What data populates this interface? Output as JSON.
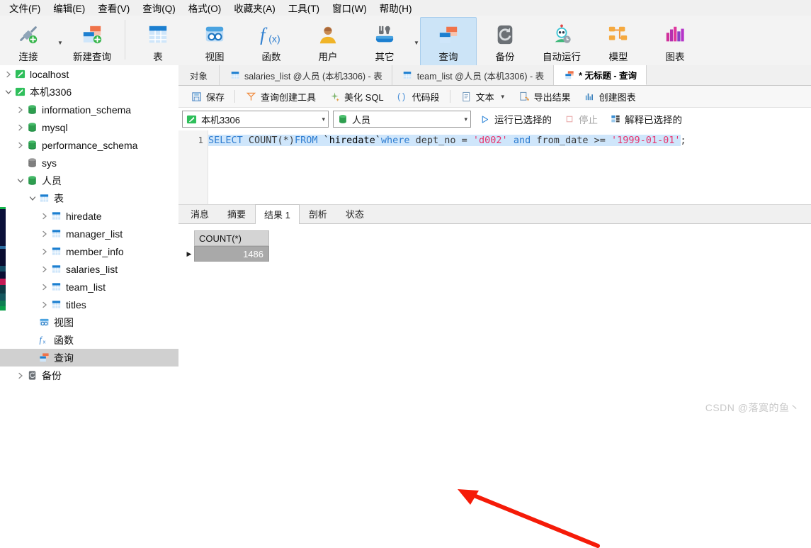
{
  "menu": {
    "items": [
      "文件(F)",
      "编辑(E)",
      "查看(V)",
      "查询(Q)",
      "格式(O)",
      "收藏夹(A)",
      "工具(T)",
      "窗口(W)",
      "帮助(H)"
    ]
  },
  "toolbar": {
    "items": [
      {
        "label": "连接",
        "icon": "plug-connect-icon",
        "selected": false
      },
      {
        "label": "新建查询",
        "icon": "new-query-icon",
        "selected": false
      },
      {
        "label": "表",
        "icon": "table-icon",
        "selected": false
      },
      {
        "label": "视图",
        "icon": "view-icon",
        "selected": false
      },
      {
        "label": "函数",
        "icon": "function-fx-icon",
        "selected": false
      },
      {
        "label": "用户",
        "icon": "user-icon",
        "selected": false
      },
      {
        "label": "其它",
        "icon": "other-tools-icon",
        "selected": false
      },
      {
        "label": "查询",
        "icon": "query-icon",
        "selected": true
      },
      {
        "label": "备份",
        "icon": "backup-icon",
        "selected": false
      },
      {
        "label": "自动运行",
        "icon": "automation-robot-icon",
        "selected": false
      },
      {
        "label": "模型",
        "icon": "model-icon",
        "selected": false
      },
      {
        "label": "图表",
        "icon": "chart-icon",
        "selected": false
      }
    ]
  },
  "sidebar": {
    "nodes": [
      {
        "label": "localhost",
        "icon": "connection-icon",
        "indent": 0,
        "expander": "collapsed",
        "active": false
      },
      {
        "label": "本机3306",
        "icon": "connection-icon",
        "indent": 0,
        "expander": "expanded",
        "active": false
      },
      {
        "label": "information_schema",
        "icon": "database-icon",
        "indent": 1,
        "expander": "collapsed",
        "active": false
      },
      {
        "label": "mysql",
        "icon": "database-icon",
        "indent": 1,
        "expander": "collapsed",
        "active": false
      },
      {
        "label": "performance_schema",
        "icon": "database-icon",
        "indent": 1,
        "expander": "collapsed",
        "active": false
      },
      {
        "label": "sys",
        "icon": "database-gray-icon",
        "indent": 1,
        "expander": "none",
        "active": false
      },
      {
        "label": "人员",
        "icon": "database-icon",
        "indent": 1,
        "expander": "expanded",
        "active": false
      },
      {
        "label": "表",
        "icon": "table-icon",
        "indent": 2,
        "expander": "expanded",
        "active": false
      },
      {
        "label": "hiredate",
        "icon": "table-icon",
        "indent": 3,
        "expander": "collapsed",
        "active": false
      },
      {
        "label": "manager_list",
        "icon": "table-icon",
        "indent": 3,
        "expander": "collapsed",
        "active": false
      },
      {
        "label": "member_info",
        "icon": "table-icon",
        "indent": 3,
        "expander": "collapsed",
        "active": false
      },
      {
        "label": "salaries_list",
        "icon": "table-icon",
        "indent": 3,
        "expander": "collapsed",
        "active": false
      },
      {
        "label": "team_list",
        "icon": "table-icon",
        "indent": 3,
        "expander": "collapsed",
        "active": false
      },
      {
        "label": "titles",
        "icon": "table-icon",
        "indent": 3,
        "expander": "collapsed",
        "active": false
      },
      {
        "label": "视图",
        "icon": "view-icon",
        "indent": 2,
        "expander": "none",
        "active": false
      },
      {
        "label": "函数",
        "icon": "function-fx-icon",
        "indent": 2,
        "expander": "none",
        "active": false
      },
      {
        "label": "查询",
        "icon": "query-icon",
        "indent": 2,
        "expander": "none",
        "active": true
      },
      {
        "label": "备份",
        "icon": "backup-icon",
        "indent": 1,
        "expander": "collapsed",
        "active": false
      }
    ]
  },
  "tabs": {
    "object_label": "对象",
    "items": [
      {
        "label": "salaries_list @人员 (本机3306) - 表",
        "icon": "table-icon",
        "selected": false
      },
      {
        "label": "team_list @人员 (本机3306) - 表",
        "icon": "table-icon",
        "selected": false
      },
      {
        "label": "* 无标题 - 查询",
        "icon": "query-icon",
        "selected": true
      }
    ]
  },
  "query_toolbar": {
    "items": [
      {
        "label": "保存",
        "icon": "save-icon"
      },
      {
        "label": "查询创建工具",
        "icon": "query-builder-icon"
      },
      {
        "label": "美化 SQL",
        "icon": "beautify-sql-icon"
      },
      {
        "label": "代码段",
        "icon": "code-snippet-icon"
      },
      {
        "label": "文本",
        "icon": "text-icon",
        "caret": true
      },
      {
        "label": "导出结果",
        "icon": "export-result-icon"
      },
      {
        "label": "创建图表",
        "icon": "create-chart-icon"
      }
    ]
  },
  "connection_bar": {
    "connection": "本机3306",
    "database": "人员",
    "run_selected": "运行已选择的",
    "stop": "停止",
    "explain_selected": "解释已选择的"
  },
  "editor": {
    "line_number": "1",
    "sql_full": "SELECT COUNT(*)FROM `hiredate`where dept_no = 'd002' and from_date >= '1999-01-01';",
    "tokens": {
      "t1": "SELECT",
      "t2": " COUNT(*)",
      "t3": "FROM",
      "t4": " `hiredate`",
      "t5": "where",
      "t6": " dept_no = ",
      "t7": "'d002'",
      "t8": " and",
      "t9": " from_date >= ",
      "t10": "'1999-01-01'",
      "t11": ";"
    }
  },
  "result_tabs": {
    "items": [
      {
        "label": "消息",
        "selected": false
      },
      {
        "label": "结果 1",
        "selected": true
      },
      {
        "label": "剖析",
        "selected": false
      },
      {
        "label": "状态",
        "selected": false
      }
    ],
    "summary_label": "摘要"
  },
  "chart_data": {
    "type": "table",
    "title": "结果 1",
    "columns": [
      "COUNT(*)"
    ],
    "rows": [
      [
        "1486"
      ]
    ],
    "row_marker": "▶"
  },
  "annotation": {
    "arrow_color": "#f51b08",
    "arrow_label": "red-arrow-pointing-to-result"
  },
  "watermark": {
    "text": "CSDN @落寞的鱼丶"
  },
  "colors": {
    "toolbar_selected": "#cce4f7",
    "tree_selected": "#d0d0d0",
    "sql_keyword": "#2e7dd1",
    "sql_string": "#e8336d",
    "sql_selection": "#cfe6fb",
    "grid_header": "#d4d4d4",
    "grid_selected_cell": "#a9a9a9"
  }
}
